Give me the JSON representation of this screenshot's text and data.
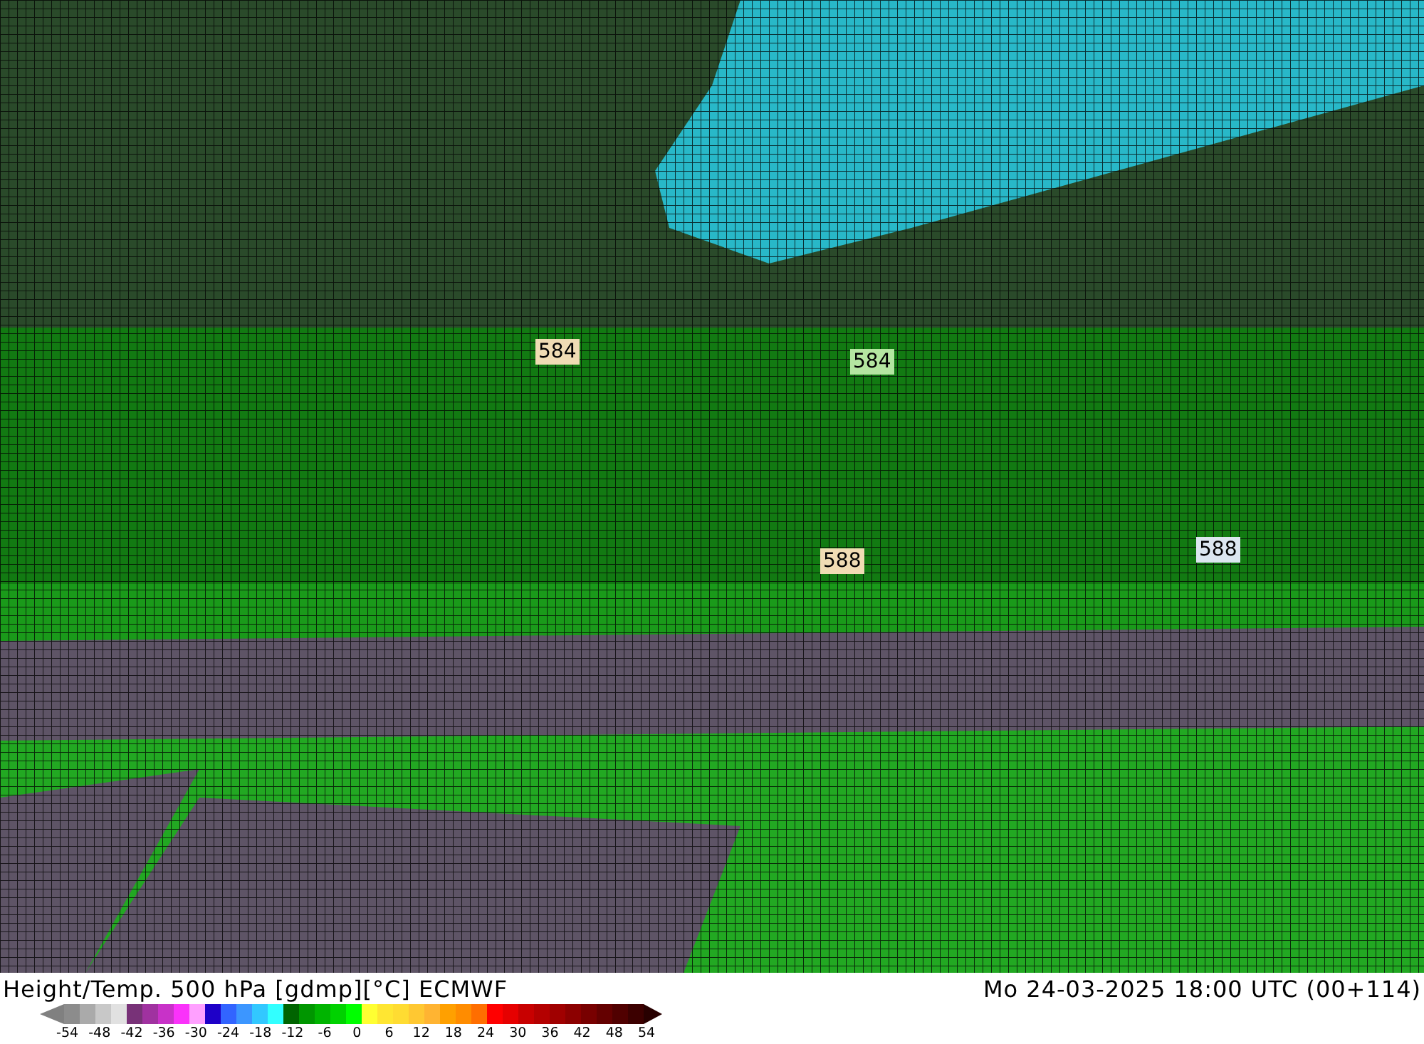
{
  "map": {
    "contour_labels": [
      {
        "text": "584",
        "color": "#f0dcb4"
      },
      {
        "text": "584",
        "color": "#b4e6a0"
      },
      {
        "text": "588",
        "color": "#f0dcb4"
      },
      {
        "text": "588",
        "color": "#dce6f0"
      }
    ]
  },
  "caption": {
    "title": "Height/Temp. 500 hPa [gdmp][°C] ECMWF",
    "valid_time": "Mo 24-03-2025 18:00 UTC (00+114)"
  },
  "legend": {
    "swatches": [
      {
        "color": "#8c8c8c"
      },
      {
        "color": "#aaaaaa"
      },
      {
        "color": "#c8c8c8"
      },
      {
        "color": "#e1e1e1"
      },
      {
        "color": "#783278"
      },
      {
        "color": "#a032a0"
      },
      {
        "color": "#c832c8"
      },
      {
        "color": "#fa32fa"
      },
      {
        "color": "#ffa0ff"
      },
      {
        "color": "#1e00c8"
      },
      {
        "color": "#3264ff"
      },
      {
        "color": "#3c96ff"
      },
      {
        "color": "#32c8ff"
      },
      {
        "color": "#32ffff"
      },
      {
        "color": "#006400"
      },
      {
        "color": "#009600"
      },
      {
        "color": "#00b400"
      },
      {
        "color": "#00d200"
      },
      {
        "color": "#00ff00"
      },
      {
        "color": "#ffff32"
      },
      {
        "color": "#ffe632"
      },
      {
        "color": "#ffdc32"
      },
      {
        "color": "#ffc832"
      },
      {
        "color": "#ffb432"
      },
      {
        "color": "#ffa000"
      },
      {
        "color": "#ff8c00"
      },
      {
        "color": "#ff6e00"
      },
      {
        "color": "#ff0000"
      },
      {
        "color": "#e60000"
      },
      {
        "color": "#c80000"
      },
      {
        "color": "#b40000"
      },
      {
        "color": "#a00000"
      },
      {
        "color": "#8c0000"
      },
      {
        "color": "#780000"
      },
      {
        "color": "#640000"
      },
      {
        "color": "#500000"
      },
      {
        "color": "#3c0000"
      }
    ],
    "ticks": [
      "-54",
      "-48",
      "-42",
      "-36",
      "-30",
      "-24",
      "-18",
      "-12",
      "-6",
      "0",
      "6",
      "12",
      "18",
      "24",
      "30",
      "36",
      "42",
      "48",
      "54"
    ]
  }
}
